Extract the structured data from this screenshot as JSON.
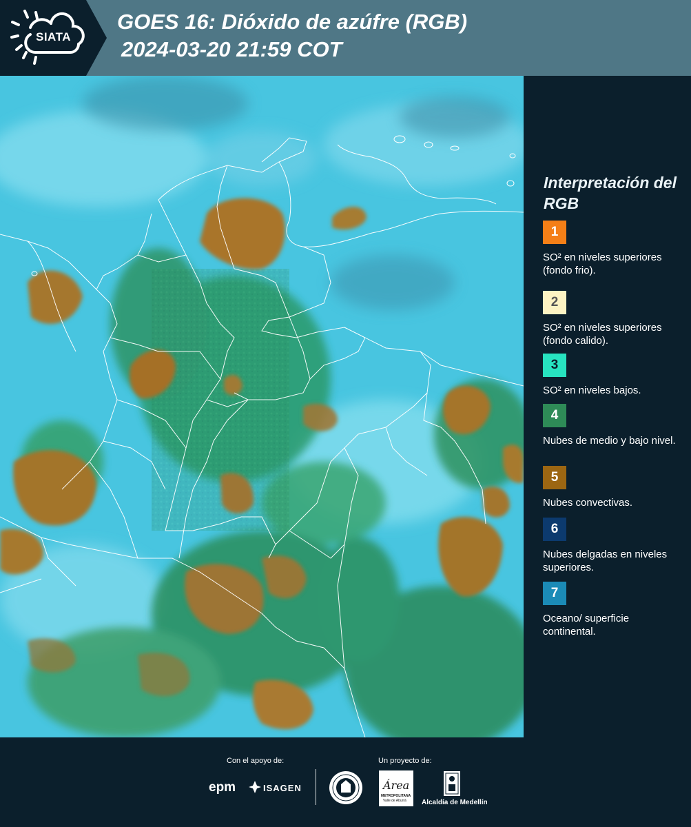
{
  "header": {
    "logo_text": "SIATA",
    "title_line1": "GOES 16: Dióxido de azúfre (RGB)",
    "title_line2": "2024-03-20 21:59 COT"
  },
  "legend": {
    "title": "Interpretación del RGB",
    "items": [
      {
        "number": "1",
        "color": "#f47f17",
        "text_color": "#ffffff",
        "label": "SO² en niveles superiores (fondo frio)."
      },
      {
        "number": "2",
        "color": "#fdf3c3",
        "text_color": "#555555",
        "label": "SO² en niveles superiores (fondo calido)."
      },
      {
        "number": "3",
        "color": "#27e3c0",
        "text_color": "#0b1f2c",
        "label": "SO² en niveles bajos."
      },
      {
        "number": "4",
        "color": "#2e8b57",
        "text_color": "#ffffff",
        "label": "Nubes de medio y bajo nivel."
      },
      {
        "number": "5",
        "color": "#9c6612",
        "text_color": "#ffffff",
        "label": "Nubes convectivas."
      },
      {
        "number": "6",
        "color": "#0c3a6e",
        "text_color": "#ffffff",
        "label": "Nubes delgadas en niveles superiores."
      },
      {
        "number": "7",
        "color": "#1b8bb7",
        "text_color": "#ffffff",
        "label": "Oceano/ superficie continental."
      }
    ]
  },
  "footer": {
    "support_label": "Con el apoyo de:",
    "project_label": "Un proyecto de:",
    "sponsors": [
      "epm",
      "ISAGEN"
    ],
    "area_logo_title": "Área",
    "area_logo_sub": "METROPOLITANA",
    "area_logo_sub2": "Valle de Aburrá",
    "alcaldia": "Alcaldía de Medellín"
  }
}
